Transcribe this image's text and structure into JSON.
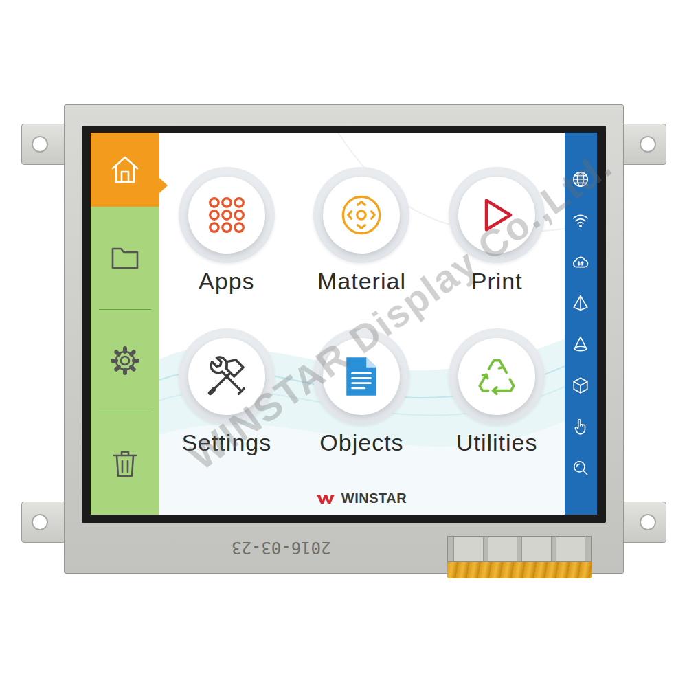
{
  "sidebar": {
    "items": [
      {
        "selected": true
      },
      {
        "selected": false
      },
      {
        "selected": false
      },
      {
        "selected": false
      }
    ]
  },
  "tiles": [
    {
      "label": "Apps"
    },
    {
      "label": "Material"
    },
    {
      "label": "Print"
    },
    {
      "label": "Settings"
    },
    {
      "label": "Objects"
    },
    {
      "label": "Utilities"
    }
  ],
  "logo": {
    "text": "WINSTAR"
  },
  "bezel": {
    "date": "2016-03-23"
  },
  "watermark": {
    "text": "WINSTAR Display Co.,Ltd."
  }
}
